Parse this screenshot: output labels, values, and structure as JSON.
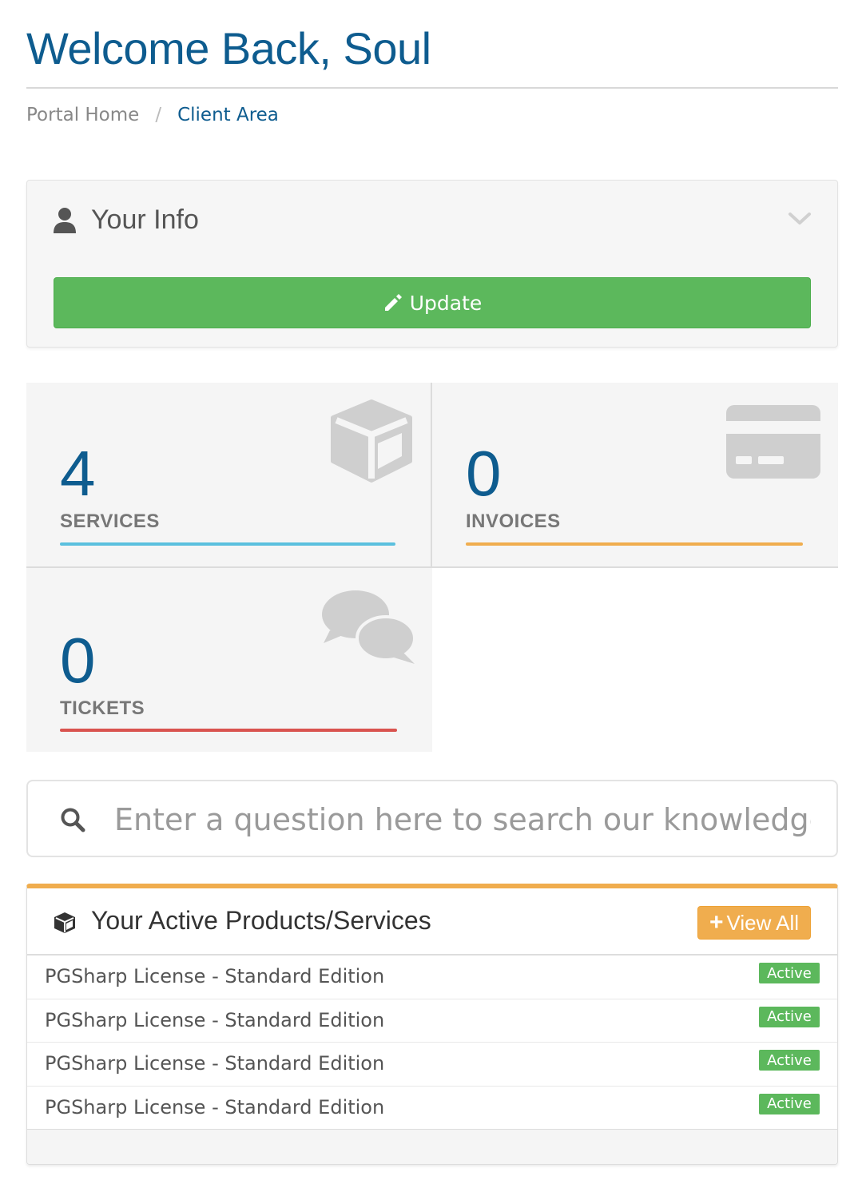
{
  "page": {
    "title": "Welcome Back, Soul"
  },
  "breadcrumb": {
    "home": "Portal Home",
    "separator": "/",
    "current": "Client Area"
  },
  "your_info": {
    "title": "Your Info",
    "update_label": "Update",
    "icons": [
      "user-icon",
      "chevron-down-icon",
      "pencil-icon"
    ]
  },
  "tiles": {
    "services": {
      "count": "4",
      "label": "SERVICES",
      "accent": "#5bc0de",
      "icon": "cube-icon"
    },
    "invoices": {
      "count": "0",
      "label": "INVOICES",
      "accent": "#f0ad4e",
      "icon": "credit-card-icon"
    },
    "tickets": {
      "count": "0",
      "label": "TICKETS",
      "accent": "#d9534f",
      "icon": "chat-bubbles-icon"
    }
  },
  "search": {
    "placeholder": "Enter a question here to search our knowledgebase"
  },
  "products": {
    "title": "Your Active Products/Services",
    "view_all_label": "View All",
    "items": [
      {
        "name": "PGSharp License - Standard Edition",
        "status": "Active"
      },
      {
        "name": "PGSharp License - Standard Edition",
        "status": "Active"
      },
      {
        "name": "PGSharp License - Standard Edition",
        "status": "Active"
      },
      {
        "name": "PGSharp License - Standard Edition",
        "status": "Active"
      }
    ]
  },
  "colors": {
    "brand_blue": "#0e5c8f",
    "success_green": "#5cb85c",
    "warning_orange": "#f0ad4e",
    "info_cyan": "#5bc0de",
    "danger_red": "#d9534f"
  }
}
